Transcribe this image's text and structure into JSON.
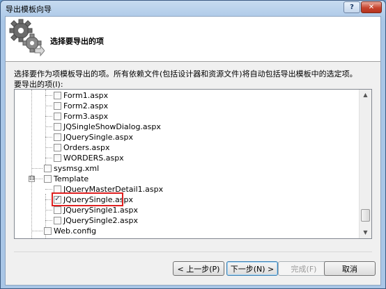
{
  "window": {
    "title": "导出模板向导"
  },
  "title_controls": {
    "help": "?",
    "close": "✕"
  },
  "header": {
    "title": "选择要导出的项",
    "icon": "gears-icon"
  },
  "description": "选择要作为项模板导出的项。所有依赖文件(包括设计器和资源文件)将自动包括导出模板中的选定项。",
  "items_label": "要导出的项(I):",
  "tree": {
    "items": [
      {
        "label": "Form1.aspx",
        "checked": false
      },
      {
        "label": "Form2.aspx",
        "checked": false
      },
      {
        "label": "Form3.aspx",
        "checked": false
      },
      {
        "label": "JQSingleShowDialog.aspx",
        "checked": false
      },
      {
        "label": "JQuerySingle.aspx",
        "checked": false
      },
      {
        "label": "Orders.aspx",
        "checked": false
      },
      {
        "label": "WORDERS.aspx",
        "checked": false
      },
      {
        "label": "sysmsg.xml",
        "checked": false
      },
      {
        "label": "Template",
        "checked": false,
        "expanded": true,
        "expander": "⊟"
      },
      {
        "label": "JQueryMasterDetail1.aspx",
        "checked": false
      },
      {
        "label": "JQuerySingle.aspx",
        "checked": true,
        "highlighted": true
      },
      {
        "label": "JQuerySingle1.aspx",
        "checked": false
      },
      {
        "label": "JQuerySingle2.aspx",
        "checked": false
      },
      {
        "label": "Web.config",
        "checked": false
      }
    ],
    "check_mark": "✓"
  },
  "buttons": {
    "back": "< 上一步(P)",
    "next": "下一步(N) >",
    "finish": "完成(F)",
    "cancel": "取消"
  }
}
